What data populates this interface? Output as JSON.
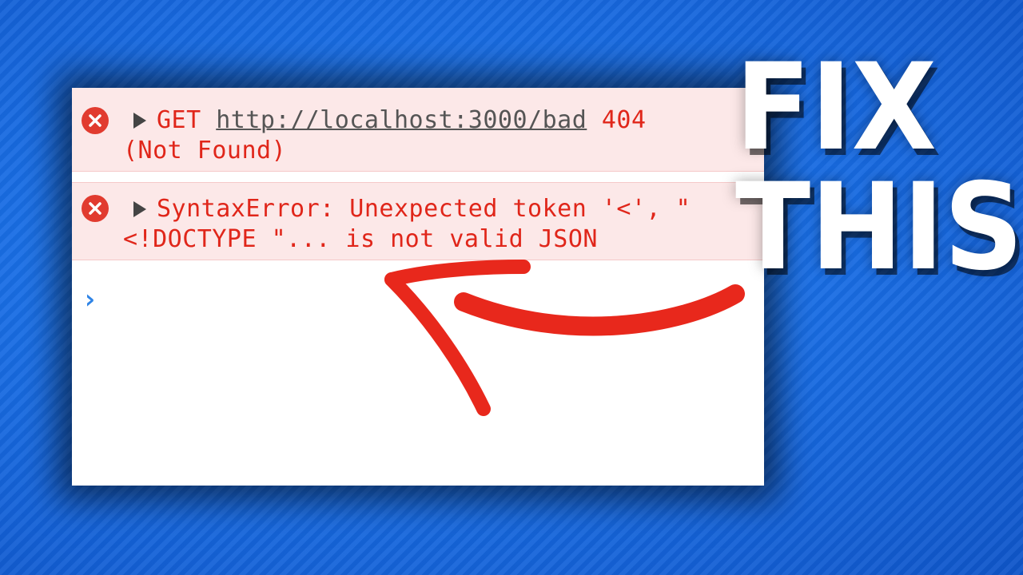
{
  "console": {
    "errors": [
      {
        "method": "GET",
        "url": "http://localhost:3000/bad",
        "status": "404",
        "status_text": "(Not Found)"
      },
      {
        "line1": "SyntaxError: Unexpected token '<', \"",
        "line2": "<!DOCTYPE \"... is not valid JSON"
      }
    ],
    "prompt_icon": "chevron-right-icon"
  },
  "headline": {
    "line1": "FIX",
    "line2": "THIS"
  },
  "colors": {
    "error_text": "#e0261a",
    "error_bg": "#fce8e8",
    "error_icon": "#e13b2f",
    "arrow": "#e8281c",
    "background": "#1a6fe6"
  }
}
